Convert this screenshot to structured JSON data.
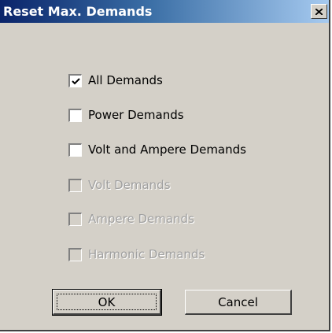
{
  "dialog": {
    "title": "Reset Max. Demands",
    "close_label": "×"
  },
  "options": [
    {
      "label": "All Demands",
      "checked": true,
      "enabled": true
    },
    {
      "label": "Power Demands",
      "checked": false,
      "enabled": true
    },
    {
      "label": "Volt and Ampere Demands",
      "checked": false,
      "enabled": true
    },
    {
      "label": "Volt Demands",
      "checked": false,
      "enabled": false
    },
    {
      "label": "Ampere Demands",
      "checked": false,
      "enabled": false
    },
    {
      "label": "Harmonic Demands",
      "checked": false,
      "enabled": false
    }
  ],
  "buttons": {
    "ok_label": "OK",
    "cancel_label": "Cancel"
  },
  "colors": {
    "title_start": "#0a246a",
    "title_end": "#a6caf0",
    "face": "#d4d0c8",
    "disabled_text": "#a0a0a0"
  },
  "icons": {
    "close": "close-icon",
    "check": "checkmark-icon"
  }
}
